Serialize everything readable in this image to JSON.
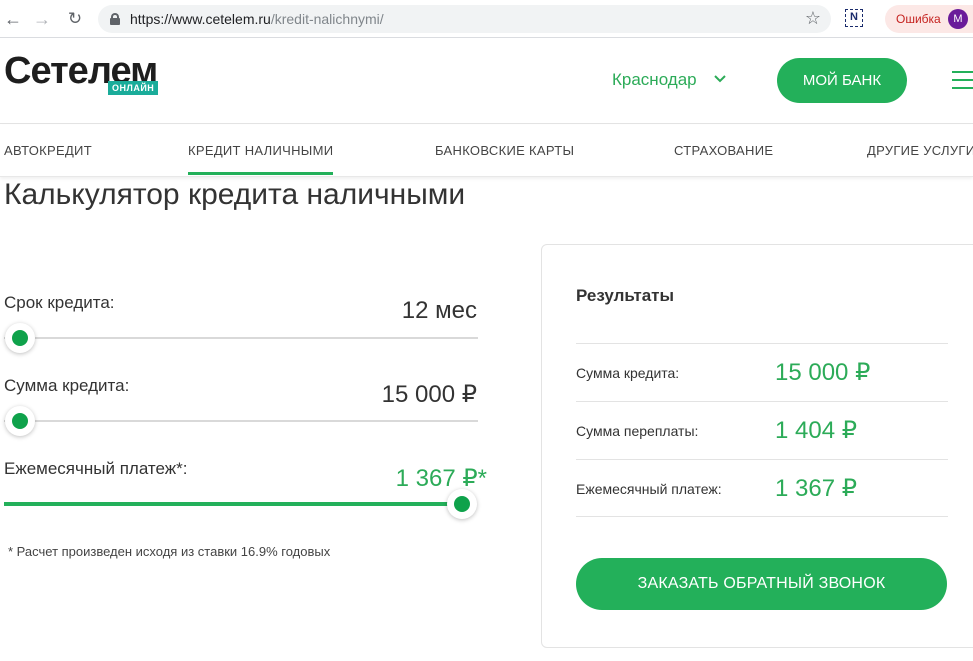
{
  "browser": {
    "url_host": "https://www.cetelem.ru",
    "url_path": "/kredit-nalichnymi/",
    "extension_label": "N",
    "error_label": "Ошибка",
    "avatar_letter": "M",
    "icons": [
      "back-icon",
      "forward-icon",
      "reload-icon",
      "lock-icon",
      "star-icon"
    ]
  },
  "header": {
    "logo_text": "Сетелем",
    "logo_badge": "ОНЛАЙН",
    "city": "Краснодар",
    "mybank_label": "МОЙ БАНК",
    "brand_color": "#23b05a"
  },
  "nav": {
    "items": [
      {
        "label": "АВТОКРЕДИТ",
        "active": false
      },
      {
        "label": "КРЕДИТ НАЛИЧНЫМИ",
        "active": true
      },
      {
        "label": "БАНКОВСКИЕ КАРТЫ",
        "active": false
      },
      {
        "label": "СТРАХОВАНИЕ",
        "active": false
      },
      {
        "label": "ДРУГИЕ УСЛУГИ",
        "active": false
      }
    ]
  },
  "calculator": {
    "title": "Калькулятор кредита наличными",
    "term": {
      "label": "Срок кредита:",
      "value": "12 мес",
      "slider_fraction": 0.0
    },
    "amount": {
      "label": "Сумма кредита:",
      "value": "15 000 ₽",
      "slider_fraction": 0.0
    },
    "payment": {
      "label": "Ежемесячный платеж*:",
      "value": "1 367 ₽*",
      "slider_fraction": 1.0
    },
    "footnote": "* Расчет произведен исходя из ставки 16.9% годовых"
  },
  "results": {
    "title": "Результаты",
    "rows": [
      {
        "label": "Сумма кредита:",
        "value": "15 000 ₽"
      },
      {
        "label": "Сумма переплаты:",
        "value": "1 404 ₽"
      },
      {
        "label": "Ежемесячный платеж:",
        "value": "1 367 ₽"
      }
    ],
    "callback_label": "ЗАКАЗАТЬ ОБРАТНЫЙ ЗВОНОК"
  }
}
